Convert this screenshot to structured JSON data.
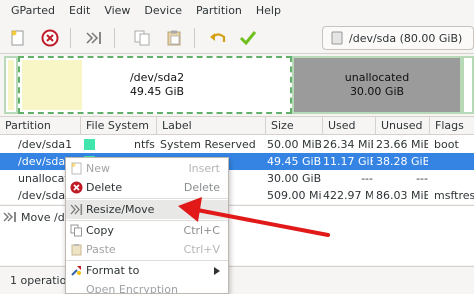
{
  "menubar": {
    "items": [
      "GParted",
      "Edit",
      "View",
      "Device",
      "Partition",
      "Help"
    ]
  },
  "toolbar": {
    "device_label": "/dev/sda (80.00 GiB)"
  },
  "disk_map": {
    "sda2": {
      "name": "/dev/sda2",
      "size": "49.45 GiB"
    },
    "unallocated": {
      "name": "unallocated",
      "size": "30.00 GiB"
    }
  },
  "table": {
    "headers": [
      "Partition",
      "File System",
      "Label",
      "Size",
      "Used",
      "Unused",
      "Flags"
    ],
    "rows": [
      {
        "partition": "/dev/sda1",
        "filesystem": "ntfs",
        "label": "System Reserved",
        "size": "50.00 MiB",
        "used": "26.34 MiB",
        "unused": "23.66 MiB",
        "flags": "boot",
        "fs_color": "#42e5ac"
      },
      {
        "partition": "/dev/sda2",
        "filesystem": "ntfs",
        "label": "",
        "size": "49.45 GiB",
        "used": "11.17 GiB",
        "unused": "38.28 GiB",
        "flags": "",
        "fs_color": "#42e5ac"
      },
      {
        "partition": "unallocated",
        "filesystem": "",
        "label": "",
        "size": "30.00 GiB",
        "used": "---",
        "unused": "---",
        "flags": "",
        "fs_color": "#a9a9a9"
      },
      {
        "partition": "/dev/sda3",
        "filesystem": "",
        "label": "",
        "size": "509.00 MiB",
        "used": "422.97 MiB",
        "unused": "86.03 MiB",
        "flags": "msftres",
        "fs_color": "#42e5ac"
      }
    ]
  },
  "operations": {
    "first_item": "Move /de"
  },
  "status": {
    "text": "1 operation"
  },
  "context_menu": {
    "items": [
      {
        "label": "New",
        "accel": "Insert",
        "icon": "new-icon",
        "disabled": true
      },
      {
        "label": "Delete",
        "accel": "Delete",
        "icon": "delete-icon",
        "disabled": false
      },
      {
        "label": "Resize/Move",
        "accel": "",
        "icon": "resize-icon",
        "disabled": false
      },
      {
        "label": "Copy",
        "accel": "Ctrl+C",
        "icon": "copy-icon",
        "disabled": false
      },
      {
        "label": "Paste",
        "accel": "Ctrl+V",
        "icon": "paste-icon",
        "disabled": true
      },
      {
        "label": "Format to",
        "accel": "",
        "icon": "format-icon",
        "disabled": false
      },
      {
        "label": "Open Encryption",
        "accel": "",
        "icon": "",
        "disabled": true
      }
    ]
  },
  "colors": {
    "selection": "#3584e4",
    "ntfs": "#42e5ac",
    "annotation_arrow": "#e11919"
  }
}
